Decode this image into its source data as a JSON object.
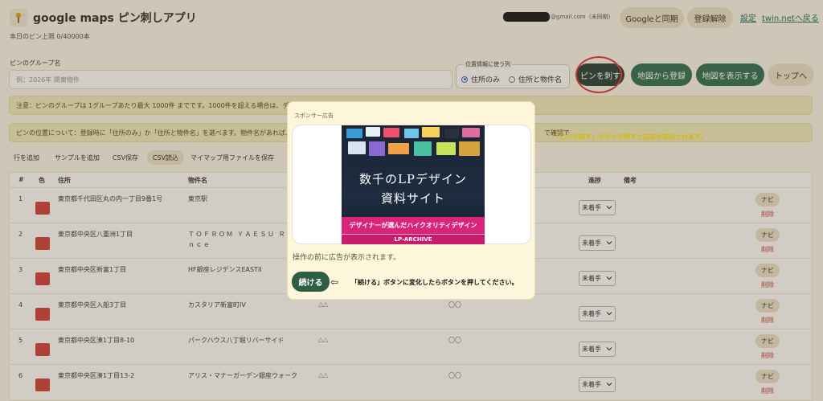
{
  "header": {
    "title": "google maps ピン刺しアプリ",
    "daily_limit": "本日のピン上限 0/40000本",
    "account_email_suffix": "@gmail.com（未同期）",
    "sync_button": "Googleと同期",
    "logout_button": "登録解除",
    "settings_link": "設定",
    "back_link": "twin.netへ戻る"
  },
  "group": {
    "label": "ピンのグループ名",
    "placeholder": "例：2026年 関東物件",
    "location_legend": "位置情報に使う列",
    "option_address_only": "住所のみ",
    "option_address_and_name": "住所と物件名",
    "pin_button": "ピンを刺す",
    "register_from_map": "地図から登録",
    "show_map": "地図を表示する",
    "top_button": "トップへ"
  },
  "notices": {
    "caution": "注意：ピンのグループは 1グループあたり最大 1000件 までです。1000件を超える場合は、データ",
    "position_info": "ピンの位置について：登録時に「住所のみ」か「住所と物件名」を選べます。物件名があれば、最",
    "position_tail": "で確認で",
    "instruction_yellow": "「ピンを刺す」ボタンを押すと広告が表示されます。"
  },
  "toolbar": {
    "add_row": "行を追加",
    "add_sample": "サンプルを追加",
    "save_csv": "CSV保存",
    "import_csv": "CSV読込",
    "save_mymap": "マイマップ用ファイルを保存"
  },
  "table": {
    "headers": {
      "num": "#",
      "color": "色",
      "address": "住所",
      "property": "物件名",
      "progress": "進捗",
      "memo": "備考"
    },
    "rows": [
      {
        "num": "1",
        "address": "東京都千代田区丸の内一丁目9番1号",
        "property": "東京駅",
        "extra1": "",
        "extra2": "",
        "status": "未着手"
      },
      {
        "num": "2",
        "address": "東京都中央区八重洲1丁目",
        "property": "ＴＯＦＲＯＭ ＹＡＥＳＵ Ｒｅｓ",
        "property2": "ｎｃｅ",
        "extra1": "",
        "extra2": "",
        "status": "未着手"
      },
      {
        "num": "3",
        "address": "東京都中央区新富1丁目",
        "property": "HF銀座レジデンスEASTII",
        "extra1": "",
        "extra2": "",
        "status": "未着手"
      },
      {
        "num": "4",
        "address": "東京都中央区入船3丁目",
        "property": "カスタリア新富町IV",
        "extra1": "△△",
        "extra2": "〇〇",
        "status": "未着手"
      },
      {
        "num": "5",
        "address": "東京都中央区湊1丁目8-10",
        "property": "パークハウス八丁堀リバーサイド",
        "extra1": "△△",
        "extra2": "〇〇",
        "status": "未着手"
      },
      {
        "num": "6",
        "address": "東京都中央区湊1丁目13-2",
        "property": "アリス・マナーガーデン銀座ウォーク",
        "extra1": "△△",
        "extra2": "〇〇",
        "status": "未着手"
      }
    ],
    "navi_label": "ナビ",
    "delete_label": "削除"
  },
  "modal": {
    "ad_label": "スポンサー広告",
    "ad_title_line1": "数千のLPデザイン",
    "ad_title_line2": "資料サイト",
    "ad_band": "デザイナーが選んだハイクオリティデザイン",
    "ad_footer": "LP-ARCHIVE",
    "message": "操作の前に広告が表示されます。",
    "continue_button": "続ける",
    "continue_note": "「続ける」ボタンに変化したらボタンを押してください。"
  },
  "colors": {
    "primary_green": "#2e6a4d",
    "pin_red": "#d23b34",
    "annotation_red": "#e23131",
    "ad_pink": "#d9247a"
  }
}
